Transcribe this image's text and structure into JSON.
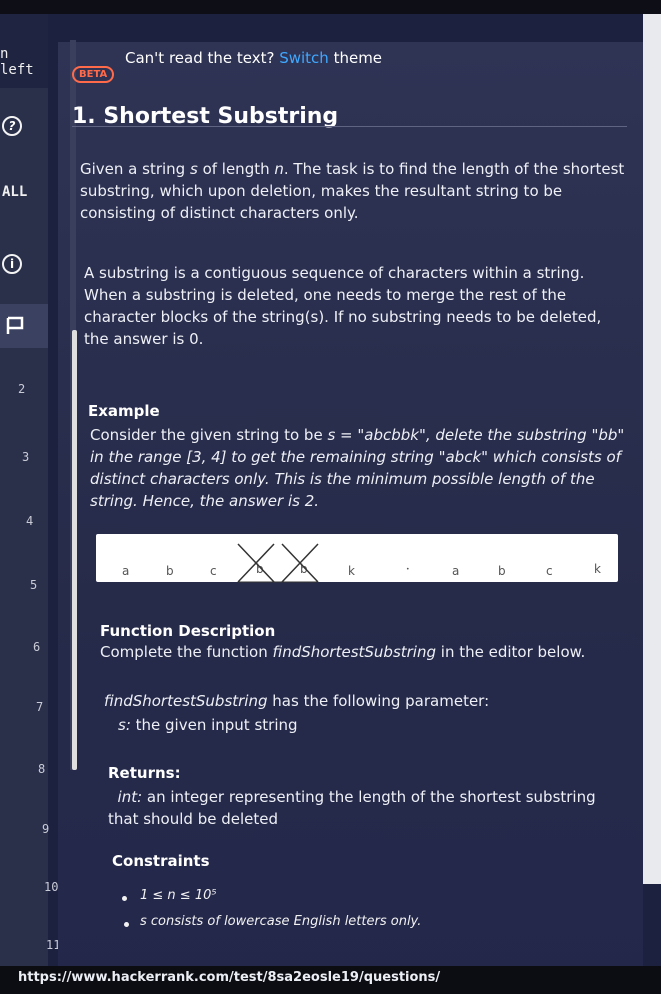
{
  "window": {
    "url": "https://www.hackerrank.com/test/8sa2eosle19/questions/"
  },
  "sidebar": {
    "time_left_label": "n left",
    "help_icon": "help-icon",
    "all_label": "ALL",
    "info_icon": "info-icon",
    "bookmark_icon": "flag-icon"
  },
  "line_numbers": [
    "2",
    "3",
    "4",
    "5",
    "6",
    "7",
    "8",
    "9",
    "10",
    "11"
  ],
  "banner": {
    "badge": "BETA",
    "text": "Can't read the text? ",
    "link": "Switch",
    "text_after": " theme"
  },
  "question": {
    "title": "1. Shortest Substring",
    "para1_a": "Given a string ",
    "para1_s": "s",
    "para1_b": " of length ",
    "para1_n": "n",
    "para1_c": ". The task is to find the length of the shortest substring, which upon deletion, makes the resultant string to be consisting of distinct characters only.",
    "para2": "A substring is a contiguous sequence of characters within a string. When a substring is deleted, one needs to merge the rest of the character blocks of the string(s). If no substring needs to be deleted, the answer is 0.",
    "example_heading": "Example",
    "example_a": "Consider the given string to be ",
    "example_b": "s = \"abcbbk\", delete the substring \"bb\" in the range [3, 4] to get the remaining string \"abck\" which consists of distinct characters only. This is the minimum possible length of the string. Hence, the answer is 2.",
    "diagram_left": [
      "a",
      "b",
      "c",
      "b",
      "b",
      "k"
    ],
    "diagram_right": [
      "a",
      "b",
      "c",
      "k"
    ],
    "fd_heading": "Function Description",
    "fd_a": "Complete the function ",
    "fd_func": "findShortestSubstring",
    "fd_b": " in the editor below.",
    "param_func": "findShortestSubstring",
    "param_text": " has the following parameter:",
    "param_s": "s:",
    "param_s_desc": " the given input string",
    "returns_heading": "Returns:",
    "returns_type": "int:",
    "returns_desc": " an integer representing the length of the shortest substring that should be deleted",
    "constraints_heading": "Constraints",
    "constraint1": "1 ≤ n ≤ 10⁵",
    "constraint2": "s consists of lowercase English letters only."
  },
  "colors": {
    "accent_link": "#3fa8ff",
    "badge": "#ff6a4a",
    "panel": "#2f3354"
  }
}
